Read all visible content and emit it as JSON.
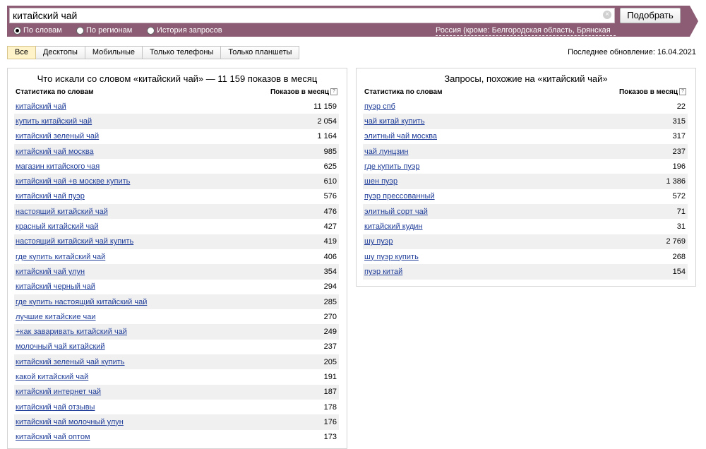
{
  "search": {
    "query": "китайский чай",
    "submit_label": "Подобрать",
    "modes": [
      {
        "label": "По словам",
        "selected": true
      },
      {
        "label": "По регионам",
        "selected": false
      },
      {
        "label": "История запросов",
        "selected": false
      }
    ],
    "region": "Россия (кроме: Белгородская область, Брянская"
  },
  "device_tabs": [
    "Все",
    "Десктопы",
    "Мобильные",
    "Только телефоны",
    "Только планшеты"
  ],
  "active_tab": "Все",
  "last_update": "Последнее обновление: 16.04.2021",
  "left_panel": {
    "title": "Что искали со словом «китайский чай» — 11 159 показов в месяц",
    "col_phrase": "Статистика по словам",
    "col_count": "Показов в месяц",
    "rows": [
      {
        "phrase": "китайский чай",
        "count": "11 159"
      },
      {
        "phrase": "купить китайский чай",
        "count": "2 054"
      },
      {
        "phrase": "китайский зеленый чай",
        "count": "1 164"
      },
      {
        "phrase": "китайский чай москва",
        "count": "985"
      },
      {
        "phrase": "магазин китайского чая",
        "count": "625"
      },
      {
        "phrase": "китайский чай +в москве купить",
        "count": "610"
      },
      {
        "phrase": "китайский чай пуэр",
        "count": "576"
      },
      {
        "phrase": "настоящий китайский чай",
        "count": "476"
      },
      {
        "phrase": "красный китайский чай",
        "count": "427"
      },
      {
        "phrase": "настоящий китайский чай купить",
        "count": "419"
      },
      {
        "phrase": "где купить китайский чай",
        "count": "406"
      },
      {
        "phrase": "китайский чай улун",
        "count": "354"
      },
      {
        "phrase": "китайский черный чай",
        "count": "294"
      },
      {
        "phrase": "где купить настоящий китайский чай",
        "count": "285"
      },
      {
        "phrase": "лучшие китайские чаи",
        "count": "270"
      },
      {
        "phrase": "+как заваривать китайский чай",
        "count": "249"
      },
      {
        "phrase": "молочный чай китайский",
        "count": "237"
      },
      {
        "phrase": "китайский зеленый чай купить",
        "count": "205"
      },
      {
        "phrase": "какой китайский чай",
        "count": "191"
      },
      {
        "phrase": "китайский интернет чай",
        "count": "187"
      },
      {
        "phrase": "китайский чай отзывы",
        "count": "178"
      },
      {
        "phrase": "китайский чай молочный улун",
        "count": "176"
      },
      {
        "phrase": "китайский чай оптом",
        "count": "173"
      }
    ]
  },
  "right_panel": {
    "title": "Запросы, похожие на «китайский чай»",
    "col_phrase": "Статистика по словам",
    "col_count": "Показов в месяц",
    "rows": [
      {
        "phrase": "пуэр спб",
        "count": "22"
      },
      {
        "phrase": "чай китай купить",
        "count": "315"
      },
      {
        "phrase": "элитный чай москва",
        "count": "317"
      },
      {
        "phrase": "чай лунцзин",
        "count": "237"
      },
      {
        "phrase": "где купить пуэр",
        "count": "196"
      },
      {
        "phrase": "шен пуэр",
        "count": "1 386"
      },
      {
        "phrase": "пуэр прессованный",
        "count": "572"
      },
      {
        "phrase": "элитный сорт чай",
        "count": "71"
      },
      {
        "phrase": "китайский кудин",
        "count": "31"
      },
      {
        "phrase": "шу пуэр",
        "count": "2 769"
      },
      {
        "phrase": "шу пуэр купить",
        "count": "268"
      },
      {
        "phrase": "пуэр китай",
        "count": "154"
      }
    ]
  },
  "colors": {
    "header_bar": "#8b5c73",
    "link": "#1f3d99",
    "active_tab": "#fff3c9",
    "row_stripe": "#f0f0f0"
  }
}
